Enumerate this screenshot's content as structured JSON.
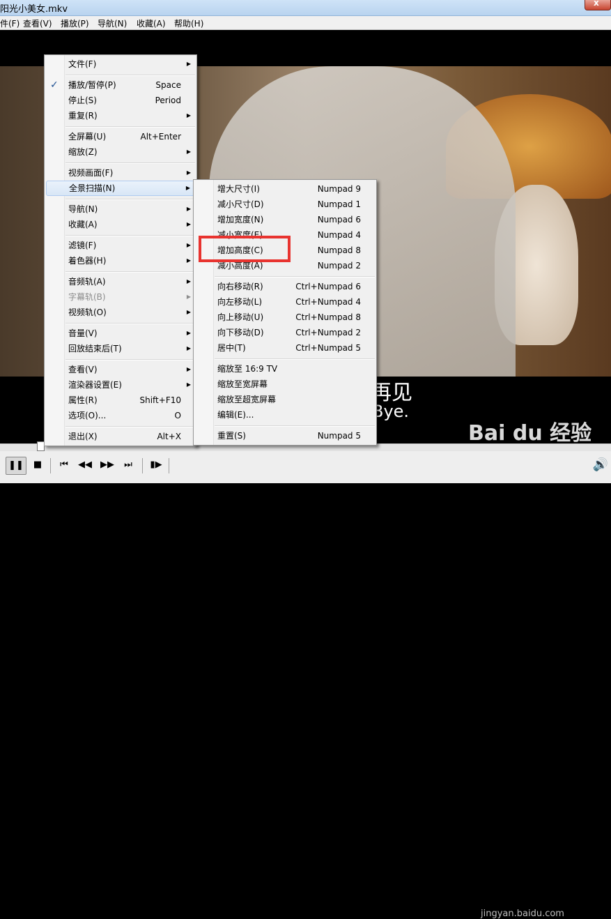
{
  "window": {
    "title": "阳光小美女.mkv",
    "close_label": "x"
  },
  "menubar": [
    "件(F)",
    "查看(V)",
    "播放(P)",
    "导航(N)",
    "收藏(A)",
    "帮助(H)"
  ],
  "video": {
    "subtitle_cn": "再见",
    "subtitle_en": "Bye."
  },
  "context_menu": {
    "items": [
      {
        "label": "文件(F)",
        "shortcut": "",
        "submenu": true
      },
      {
        "label": "播放/暂停(P)",
        "shortcut": "Space",
        "checked": true
      },
      {
        "label": "停止(S)",
        "shortcut": "Period"
      },
      {
        "label": "重复(R)",
        "shortcut": "",
        "submenu": true
      },
      {
        "label": "全屏幕(U)",
        "shortcut": "Alt+Enter"
      },
      {
        "label": "缩放(Z)",
        "shortcut": "",
        "submenu": true
      },
      {
        "label": "视频画面(F)",
        "shortcut": "",
        "submenu": true
      },
      {
        "label": "全景扫描(N)",
        "shortcut": "",
        "submenu": true,
        "highlighted": true
      },
      {
        "label": "导航(N)",
        "shortcut": "",
        "submenu": true
      },
      {
        "label": "收藏(A)",
        "shortcut": "",
        "submenu": true
      },
      {
        "label": "滤镜(F)",
        "shortcut": "",
        "submenu": true
      },
      {
        "label": "着色器(H)",
        "shortcut": "",
        "submenu": true
      },
      {
        "label": "音频轨(A)",
        "shortcut": "",
        "submenu": true
      },
      {
        "label": "字幕轨(B)",
        "shortcut": "",
        "submenu": true,
        "disabled": true
      },
      {
        "label": "视频轨(O)",
        "shortcut": "",
        "submenu": true
      },
      {
        "label": "音量(V)",
        "shortcut": "",
        "submenu": true
      },
      {
        "label": "回放结束后(T)",
        "shortcut": "",
        "submenu": true
      },
      {
        "label": "查看(V)",
        "shortcut": "",
        "submenu": true
      },
      {
        "label": "渲染器设置(E)",
        "shortcut": "",
        "submenu": true
      },
      {
        "label": "属性(R)",
        "shortcut": "Shift+F10"
      },
      {
        "label": "选项(O)...",
        "shortcut": "O"
      },
      {
        "label": "退出(X)",
        "shortcut": "Alt+X"
      }
    ]
  },
  "pan_scan_submenu": {
    "items": [
      {
        "label": "增大尺寸(I)",
        "shortcut": "Numpad 9"
      },
      {
        "label": "减小尺寸(D)",
        "shortcut": "Numpad 1"
      },
      {
        "label": "增加宽度(N)",
        "shortcut": "Numpad 6"
      },
      {
        "label": "减小宽度(E)",
        "shortcut": "Numpad 4"
      },
      {
        "label": "增加高度(C)",
        "shortcut": "Numpad 8",
        "annotated": true
      },
      {
        "label": "减小高度(A)",
        "shortcut": "Numpad 2"
      },
      {
        "label": "向右移动(R)",
        "shortcut": "Ctrl+Numpad 6"
      },
      {
        "label": "向左移动(L)",
        "shortcut": "Ctrl+Numpad 4"
      },
      {
        "label": "向上移动(U)",
        "shortcut": "Ctrl+Numpad 8"
      },
      {
        "label": "向下移动(D)",
        "shortcut": "Ctrl+Numpad 2"
      },
      {
        "label": "居中(T)",
        "shortcut": "Ctrl+Numpad 5"
      },
      {
        "label": "缩放至 16:9 TV",
        "shortcut": ""
      },
      {
        "label": "缩放至宽屏幕",
        "shortcut": ""
      },
      {
        "label": "缩放至超宽屏幕",
        "shortcut": ""
      },
      {
        "label": "编辑(E)...",
        "shortcut": ""
      },
      {
        "label": "重置(S)",
        "shortcut": "Numpad 5"
      }
    ]
  },
  "controls": {
    "icons": [
      "pause-icon",
      "stop-icon",
      "skip-back-icon",
      "rewind-icon",
      "fast-forward-icon",
      "skip-forward-icon",
      "frame-step-icon",
      "volume-icon"
    ]
  },
  "watermark": {
    "text": "Bai du 经验",
    "sub": "jingyan.baidu.com"
  },
  "colors": {
    "annotation": "#e8332f",
    "menu_bg": "#f0f0f0",
    "highlight": "#d8e6f6"
  }
}
